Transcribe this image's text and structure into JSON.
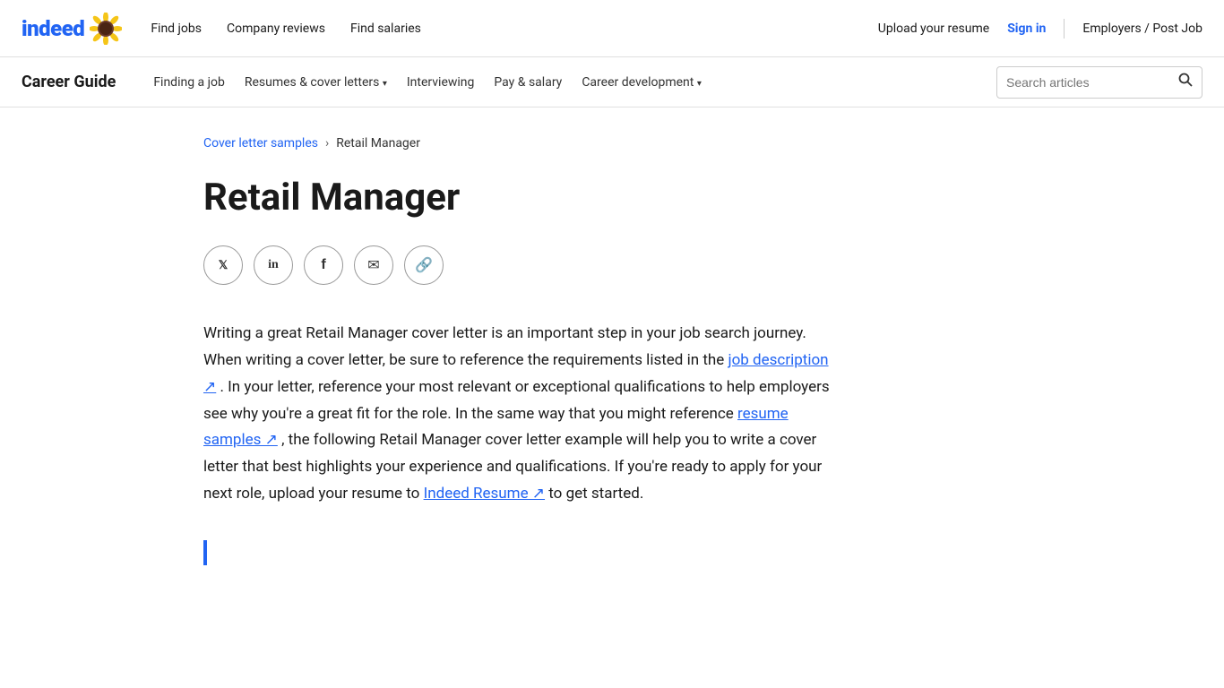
{
  "topnav": {
    "logo_text": "indeed",
    "links": [
      {
        "label": "Find jobs",
        "name": "find-jobs-link"
      },
      {
        "label": "Company reviews",
        "name": "company-reviews-link"
      },
      {
        "label": "Find salaries",
        "name": "find-salaries-link"
      }
    ],
    "upload_resume": "Upload your resume",
    "sign_in": "Sign in",
    "employers": "Employers / Post Job"
  },
  "secondarynav": {
    "title": "Career Guide",
    "links": [
      {
        "label": "Finding a job",
        "name": "finding-job-link",
        "has_dropdown": false
      },
      {
        "label": "Resumes & cover letters",
        "name": "resumes-link",
        "has_dropdown": true
      },
      {
        "label": "Interviewing",
        "name": "interviewing-link",
        "has_dropdown": false
      },
      {
        "label": "Pay & salary",
        "name": "pay-salary-link",
        "has_dropdown": false
      },
      {
        "label": "Career development",
        "name": "career-dev-link",
        "has_dropdown": true
      }
    ],
    "search_placeholder": "Search articles"
  },
  "breadcrumb": {
    "parent_label": "Cover letter samples",
    "current_label": "Retail Manager",
    "separator": "›"
  },
  "article": {
    "title": "Retail Manager",
    "body_p1": "Writing a great Retail Manager cover letter is an important step in your job search journey. When writing a cover letter, be sure to reference the requirements listed in the",
    "job_description_link": "job description",
    "body_p1_cont": ". In your letter, reference your most relevant or exceptional qualifications to help employers see why you're a great fit for the role. In the same way that you might reference",
    "resume_samples_link": "resume samples",
    "body_p2_cont": ", the following Retail Manager cover letter example will help you to write a cover letter that best highlights your experience and qualifications. If you're ready to apply for your next role, upload your resume to",
    "indeed_resume_link": "Indeed Resume",
    "body_p2_end": "to get started."
  },
  "social": {
    "buttons": [
      {
        "icon": "twitter",
        "label": "Share on Twitter",
        "symbol": "𝕏"
      },
      {
        "icon": "linkedin",
        "label": "Share on LinkedIn",
        "symbol": "in"
      },
      {
        "icon": "facebook",
        "label": "Share on Facebook",
        "symbol": "f"
      },
      {
        "icon": "email",
        "label": "Share via Email",
        "symbol": "✉"
      },
      {
        "icon": "link",
        "label": "Copy link",
        "symbol": "🔗"
      }
    ]
  }
}
